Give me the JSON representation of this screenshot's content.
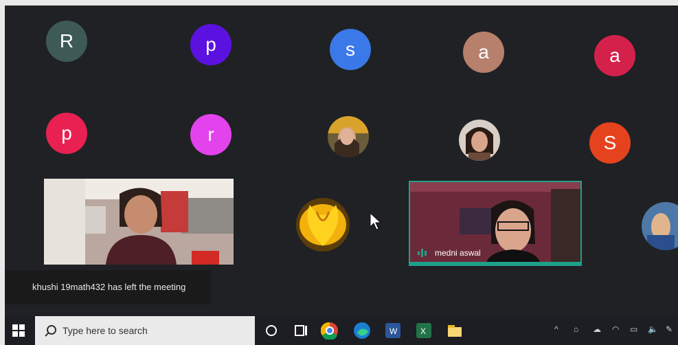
{
  "participants": [
    {
      "initial": "R",
      "color": "#3d5a57"
    },
    {
      "initial": "p",
      "color": "#5b12e0"
    },
    {
      "initial": "s",
      "color": "#3b78e8"
    },
    {
      "initial": "a",
      "color": "#b7806c"
    },
    {
      "initial": "a",
      "color": "#d4214b"
    },
    {
      "initial": "p",
      "color": "#e82152"
    },
    {
      "initial": "r",
      "color": "#e343ec"
    },
    {
      "initial": "S",
      "color": "#e5431e"
    }
  ],
  "video_tile_right": {
    "name": "medni aswal"
  },
  "notification": {
    "text": "khushi 19math432 has left the meeting"
  },
  "taskbar": {
    "search_placeholder": "Type here to search",
    "icons": [
      "windows-start-icon",
      "search-icon",
      "task-view-circle-icon",
      "task-view-icon",
      "chrome-icon",
      "edge-icon",
      "word-icon",
      "excel-icon",
      "file-explorer-icon"
    ]
  }
}
